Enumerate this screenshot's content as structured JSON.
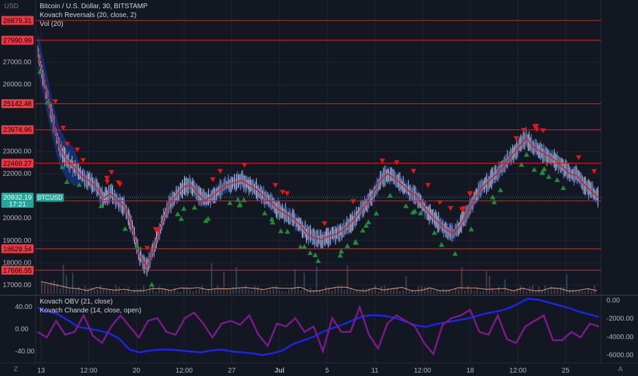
{
  "header": {
    "currency_label": "USD",
    "legend_main": "Bitcoin / U.S. Dollar, 30, BITSTAMP",
    "legend_kovach_reversals": "Kovach Reversals (20, close, 2)",
    "legend_volume": "Vol (20)",
    "legend_obv": "Kovach OBV (21, close)",
    "legend_chande": "Kovach Chande (14, close, open)",
    "left_axis_corner": "Z",
    "right_axis_corner": "A"
  },
  "colors": {
    "background": "#131722",
    "grid": "#1f2430",
    "level_line": "#e0181c",
    "level_label_bg": "#f23645",
    "price_mid": "#c4232d",
    "band": "#1f3fa6",
    "candle_up": "#9aa1b6",
    "candle_down": "#e2e4ea",
    "signal_up": "#1e8c3a",
    "signal_down": "#e0181c",
    "obv_line": "#1d26e8",
    "chande_line": "#7c1a8c",
    "current_price_bg": "#26a69a",
    "axis_text": "#b2b5be"
  },
  "chart_data": [
    {
      "type": "line",
      "title": "Bitcoin / U.S. Dollar, 30, BITSTAMP",
      "x_axis_ticks": [
        "13",
        "12:00",
        "20",
        "12:00",
        "27",
        "Jul",
        "5",
        "11",
        "12:00",
        "18",
        "12:00",
        "25"
      ],
      "y_axis_ticks": [
        "27000.00",
        "26000.00",
        "23000.00",
        "22000.00",
        "21000.00",
        "20000.00",
        "19000.00",
        "18000.00",
        "17000.00"
      ],
      "ylim": [
        16600,
        29000
      ],
      "horizontal_levels": [
        28879.31,
        27990.99,
        25142.46,
        23974.96,
        22469.27,
        20780.43,
        18629.54,
        17666.55
      ],
      "current_price": {
        "symbol": "BTCUSD",
        "value": "20932.19",
        "countdown": "17:21"
      },
      "series": [
        {
          "name": "Bitcoin / U.S. Dollar",
          "values": [
            27500,
            26000,
            24500,
            23200,
            22600,
            22300,
            21900,
            21700,
            21400,
            20900,
            21100,
            20800,
            20500,
            19500,
            18300,
            17800,
            18700,
            19700,
            20600,
            21000,
            21400,
            21500,
            21100,
            20800,
            21000,
            21300,
            21500,
            21600,
            21700,
            21500,
            21300,
            21000,
            20700,
            20400,
            20200,
            20000,
            19700,
            19300,
            19100,
            19050,
            19200,
            19300,
            19500,
            19800,
            20200,
            20600,
            21100,
            21700,
            22000,
            21800,
            21500,
            21200,
            21000,
            20500,
            20100,
            19800,
            19500,
            19300,
            19700,
            20300,
            20900,
            21400,
            21700,
            22000,
            22400,
            22800,
            23200,
            23600,
            23200,
            23000,
            22800,
            22600,
            22300,
            22000,
            21900,
            21500,
            21200,
            20900
          ]
        }
      ],
      "signals_up_count": 60,
      "signals_down_count": 40
    },
    {
      "type": "bar",
      "title": "Vol (20)"
    },
    {
      "type": "line",
      "title": "Kovach OBV (21, close) / Kovach Chande (14, close, open)",
      "x_axis_ticks": [
        "13",
        "12:00",
        "20",
        "12:00",
        "27",
        "Jul",
        "5",
        "11",
        "12:00",
        "18",
        "12:00",
        "25"
      ],
      "left_axis": {
        "ticks": [
          "40.00",
          "0.00",
          "-40.00"
        ],
        "ylim": [
          -60,
          60
        ]
      },
      "right_axis": {
        "ticks": [
          "0.00",
          "-2000.00",
          "-4000.00",
          "-6000.00"
        ],
        "ylim": [
          -6800,
          500
        ]
      },
      "series": [
        {
          "name": "Kovach OBV (21, close)",
          "axis": "right",
          "values": [
            -800,
            -1200,
            -1500,
            -2200,
            -2900,
            -3100,
            -3300,
            -3600,
            -4200,
            -5400,
            -5700,
            -5500,
            -5400,
            -5400,
            -5500,
            -5600,
            -5700,
            -5500,
            -5400,
            -5600,
            -5700,
            -5800,
            -6000,
            -5800,
            -5500,
            -4800,
            -4400,
            -4000,
            -3400,
            -3000,
            -2600,
            -2100,
            -1700,
            -1600,
            -1700,
            -1900,
            -2300,
            -2700,
            -2900,
            -2600,
            -2400,
            -2200,
            -2000,
            -1700,
            -1400,
            -1200,
            -900,
            -400,
            200,
            100,
            -200,
            -500,
            -800,
            -1200,
            -1500,
            -1800
          ]
        },
        {
          "name": "Kovach Chande (14, close, open)",
          "axis": "left",
          "values": [
            -5,
            -15,
            15,
            -10,
            -5,
            25,
            -12,
            -25,
            5,
            25,
            5,
            -15,
            15,
            20,
            -5,
            -10,
            20,
            30,
            10,
            -15,
            10,
            15,
            8,
            25,
            -10,
            -30,
            10,
            5,
            20,
            -5,
            5,
            -40,
            20,
            -5,
            -5,
            40,
            -10,
            -35,
            10,
            25,
            15,
            5,
            -25,
            -45,
            8,
            20,
            25,
            35,
            -5,
            -10,
            25,
            -18,
            -25,
            5,
            15,
            25,
            -20,
            -20,
            -5,
            -15,
            10,
            5
          ]
        }
      ]
    }
  ]
}
